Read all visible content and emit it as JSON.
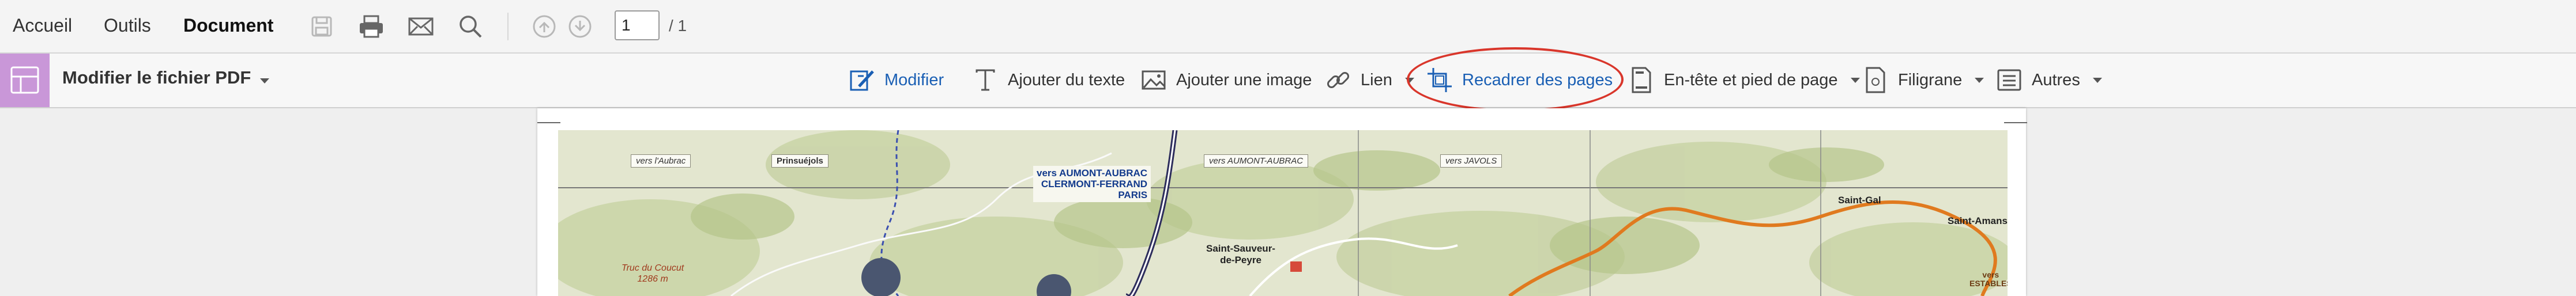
{
  "menu": {
    "tabs": [
      {
        "label": "Accueil"
      },
      {
        "label": "Outils"
      },
      {
        "label": "Document"
      }
    ],
    "page_number": "1",
    "page_total": "/ 1"
  },
  "editbar": {
    "title": "Modifier le fichier PDF",
    "tools": [
      {
        "label": "Modifier",
        "icon": "edit-icon"
      },
      {
        "label": "Ajouter du texte",
        "icon": "text-icon"
      },
      {
        "label": "Ajouter une image",
        "icon": "image-icon"
      },
      {
        "label": "Lien",
        "icon": "link-icon"
      },
      {
        "label": "Recadrer des pages",
        "icon": "crop-icon"
      },
      {
        "label": "En-tête et pied de page",
        "icon": "header-footer-icon"
      },
      {
        "label": "Filigrane",
        "icon": "watermark-icon"
      },
      {
        "label": "Autres",
        "icon": "more-icon"
      }
    ]
  },
  "map": {
    "directions": [
      "vers l'Aubrac",
      "vers AUMONT-AUBRAC",
      "vers JAVOLS"
    ],
    "highway_destination": [
      "vers AUMONT-AUBRAC",
      "CLERMONT-FERRAND",
      "PARIS"
    ],
    "places": [
      "Prinsuéjols",
      "Saint-Sauveur-",
      "de-Peyre",
      "Saint-Gal",
      "Saint-Amans"
    ],
    "peak": [
      "Truc du Coucut",
      "1286 m"
    ],
    "road_destination": [
      "vers",
      "ESTABLES"
    ]
  },
  "colors": {
    "accent_blue": "#1a5fb4",
    "highlight_red": "#d9362b",
    "tool_badge": "#c997d8",
    "route_orange": "#e07a1f"
  }
}
